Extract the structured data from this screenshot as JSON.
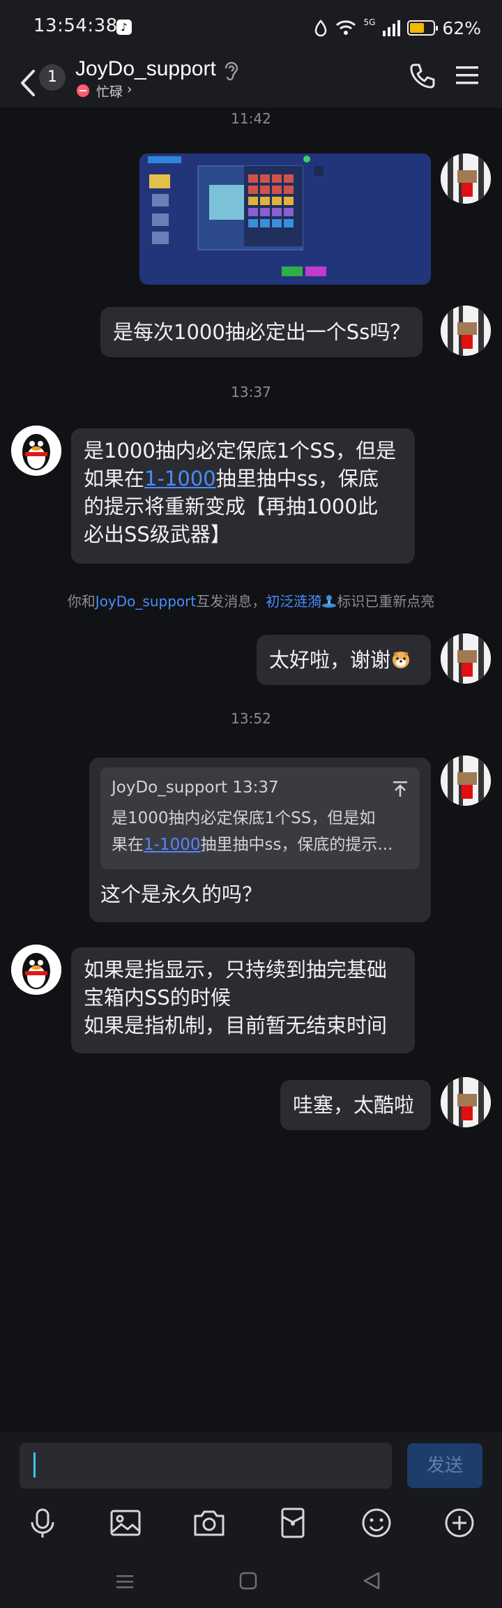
{
  "status_bar": {
    "time": "13:54:38",
    "network": "5G",
    "battery_text": "62%",
    "battery_level": 0.62
  },
  "header": {
    "unread_count": "1",
    "contact_name": "JoyDo_support",
    "status_text": "忙碌",
    "icons": [
      "back-icon",
      "ear-icon",
      "phone-icon",
      "menu-icon"
    ]
  },
  "chat": {
    "time_1": "11:42",
    "msg_1_text": "是每次1000抽必定出一个Ss吗？",
    "time_2": "13:37",
    "msg_2": {
      "line1": "是1000抽内必定保底1个SS，但是",
      "line2_pre": "如果在",
      "line2_link": "1-1000",
      "line2_post": "抽里抽中ss，保底",
      "line3": "的提示将重新变成【再抽1000此",
      "line4": "必出SS级武器】"
    },
    "system": {
      "pre": "你和",
      "name": "JoyDo_support",
      "mid": "互发消息，",
      "badge_name": "初泛涟漪",
      "post": "标识已重新点亮"
    },
    "msg_3_text": "太好啦，谢谢",
    "time_3": "13:52",
    "msg_4": {
      "reply_header": "JoyDo_support 13:37",
      "reply_line1": "是1000抽内必定保底1个SS，但是如",
      "reply_line2_pre": "果在",
      "reply_line2_link": "1-1000",
      "reply_line2_post": "抽里抽中ss，保底的提示...",
      "text": "这个是永久的吗？"
    },
    "msg_5": {
      "line1": "如果是指显示，只持续到抽完基础",
      "line2": "宝箱内SS的时候",
      "line3": "如果是指机制，目前暂无结束时间"
    },
    "msg_6_text": "哇塞，太酷啦"
  },
  "input": {
    "value": "",
    "send_label": "发送"
  },
  "toolbar_icons": [
    "mic-icon",
    "image-icon",
    "camera-icon",
    "red-packet-icon",
    "emoji-icon",
    "plus-icon"
  ],
  "nav_icons": [
    "recent-apps-icon",
    "home-icon",
    "back-nav-icon"
  ],
  "colors": {
    "background": "#111215",
    "bubble": "#2b2c31",
    "link": "#4a8cff",
    "send_button": "#1d3d6b"
  }
}
